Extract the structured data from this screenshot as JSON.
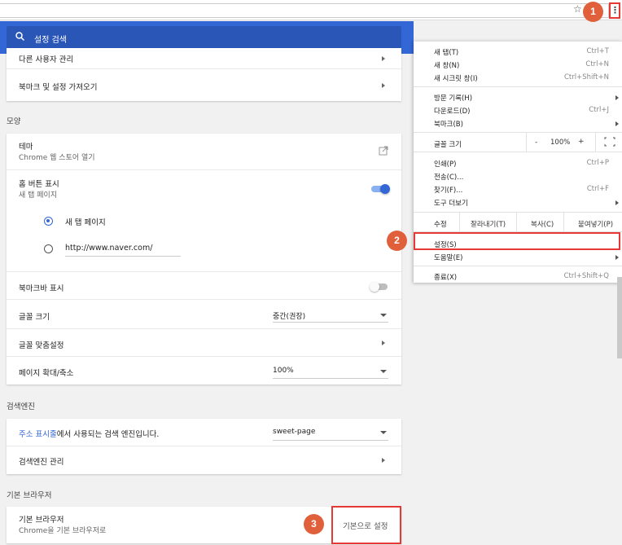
{
  "toolbar": {
    "star_icon": "star-icon",
    "menu_icon": "kebab-menu-icon"
  },
  "search": {
    "placeholder": "설정 검색"
  },
  "people": {
    "manage_others": "다른 사용자 관리",
    "import_bookmarks": "북마크 및 설정 가져오기"
  },
  "appearance": {
    "section": "모양",
    "theme_label": "테마",
    "theme_sub": "Chrome 웹 스토어 열기",
    "home_label": "홈 버튼 표시",
    "home_sub": "새 탭 페이지",
    "radio_newtab": "새 탭 페이지",
    "radio_url": "http://www.naver.com/",
    "bookmarks_bar": "북마크바 표시",
    "font_size_label": "글꼴 크기",
    "font_size_value": "중간(권장)",
    "font_custom": "글꼴 맞춤설정",
    "zoom_label": "페이지 확대/축소",
    "zoom_value": "100%"
  },
  "search_engine": {
    "section": "검색엔진",
    "link_text": "주소 표시줄",
    "used_text": "에서 사용되는 검색 엔진입니다.",
    "engine_value": "sweet-page",
    "manage": "검색엔진 관리"
  },
  "default_browser": {
    "section": "기본 브라우저",
    "label": "기본 브라우저",
    "sub": "Chrome을 기본 브라우저로",
    "button": "기본으로 설정"
  },
  "menu": {
    "new_tab": "새 탭(T)",
    "new_tab_key": "Ctrl+T",
    "new_window": "새 창(N)",
    "new_window_key": "Ctrl+N",
    "incognito": "새 시크릿 창(I)",
    "incognito_key": "Ctrl+Shift+N",
    "history": "방문 기록(H)",
    "downloads": "다운로드(D)",
    "downloads_key": "Ctrl+J",
    "bookmarks": "북마크(B)",
    "zoom_label": "글꼴 크기",
    "zoom_minus": "-",
    "zoom_value": "100%",
    "zoom_plus": "+",
    "print": "인쇄(P)",
    "print_key": "Ctrl+P",
    "cast": "전송(C)...",
    "find": "찾기(F)...",
    "find_key": "Ctrl+F",
    "more_tools": "도구 더보기",
    "edit": "수정",
    "cut": "잘라내기(T)",
    "copy": "복사(C)",
    "paste": "붙여넣기(P)",
    "settings": "설정(S)",
    "help": "도움말(E)",
    "exit": "종료(X)",
    "exit_key": "Ctrl+Shift+Q"
  },
  "badges": {
    "one": "1",
    "two": "2",
    "three": "3"
  },
  "colors": {
    "accent": "#3367d6",
    "highlight": "#e53935",
    "badge": "#e0603c"
  }
}
